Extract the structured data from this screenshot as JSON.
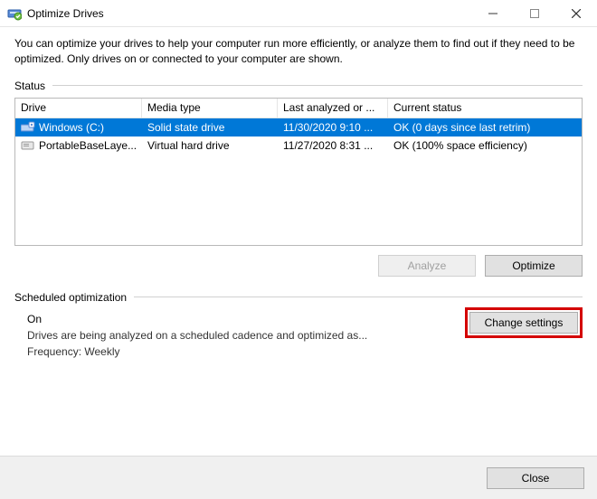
{
  "window": {
    "title": "Optimize Drives",
    "description": "You can optimize your drives to help your computer run more efficiently, or analyze them to find out if they need to be optimized. Only drives on or connected to your computer are shown."
  },
  "sections": {
    "status_label": "Status",
    "scheduled_label": "Scheduled optimization"
  },
  "columns": {
    "drive": "Drive",
    "media": "Media type",
    "last": "Last analyzed or ...",
    "status": "Current status"
  },
  "rows": [
    {
      "drive": "Windows (C:)",
      "media": "Solid state drive",
      "last": "11/30/2020 9:10 ...",
      "status": "OK (0 days since last retrim)",
      "selected": true
    },
    {
      "drive": "PortableBaseLaye...",
      "media": "Virtual hard drive",
      "last": "11/27/2020 8:31 ...",
      "status": "OK (100% space efficiency)",
      "selected": false
    }
  ],
  "buttons": {
    "analyze": "Analyze",
    "optimize": "Optimize",
    "change_settings": "Change settings",
    "close": "Close"
  },
  "schedule": {
    "state": "On",
    "line1": "Drives are being analyzed on a scheduled cadence and optimized as...",
    "frequency_label": "Frequency:",
    "frequency_value": "Weekly"
  }
}
